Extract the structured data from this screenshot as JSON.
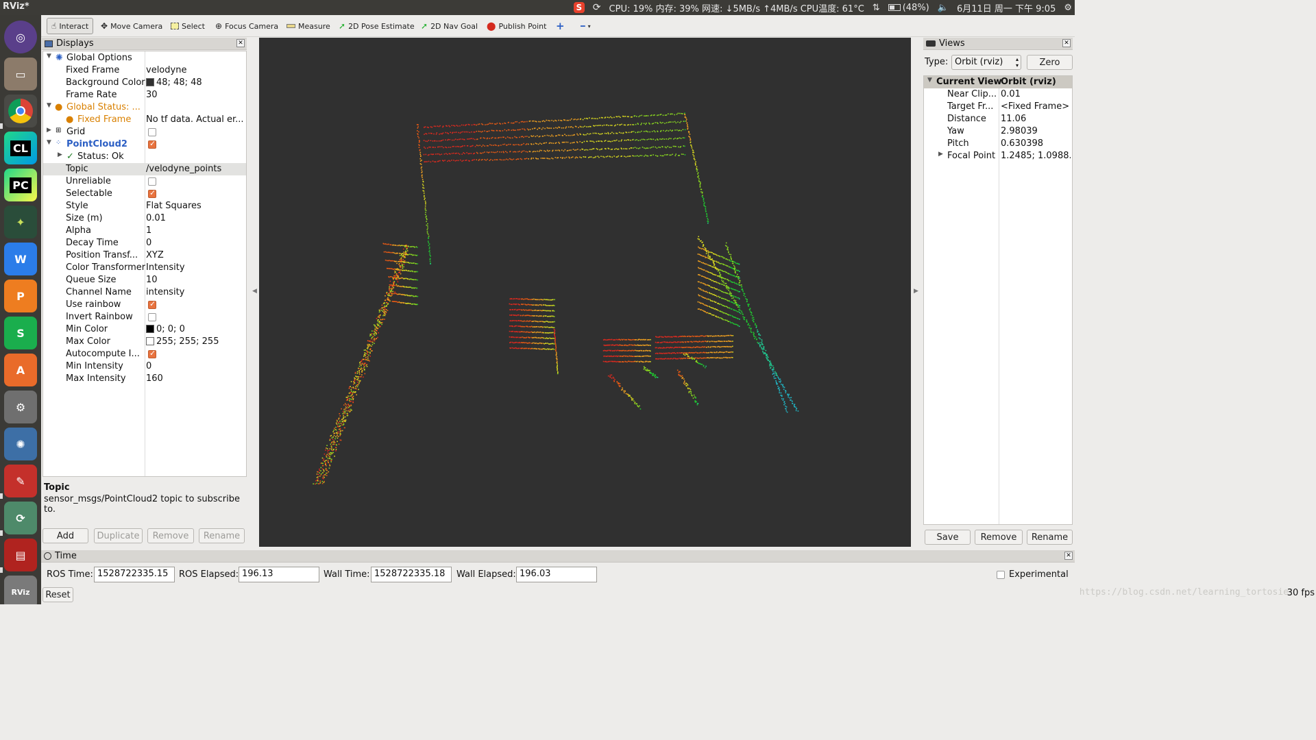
{
  "topbar": {
    "app_title": "RViz*",
    "status": "CPU: 19% 内存: 39% 网速: ↓5MB/s ↑4MB/s CPU温度: 61°C",
    "battery": "(48%)",
    "datetime": "6月11日 周一 下午 9:05"
  },
  "toolbar": {
    "interact": "Interact",
    "move_camera": "Move Camera",
    "select": "Select",
    "focus_camera": "Focus Camera",
    "measure": "Measure",
    "pose_estimate": "2D Pose Estimate",
    "nav_goal": "2D Nav Goal",
    "publish_point": "Publish Point"
  },
  "displays": {
    "title": "Displays",
    "rows": [
      {
        "name": "Global Options",
        "value": ""
      },
      {
        "name": "Fixed Frame",
        "value": "velodyne"
      },
      {
        "name": "Background Color",
        "value": "48; 48; 48"
      },
      {
        "name": "Frame Rate",
        "value": "30"
      },
      {
        "name": "Global Status: ...",
        "value": ""
      },
      {
        "name": "Fixed Frame",
        "value": "No tf data.  Actual er..."
      },
      {
        "name": "Grid",
        "value": ""
      },
      {
        "name": "PointCloud2",
        "value": ""
      },
      {
        "name": "Status: Ok",
        "value": ""
      },
      {
        "name": "Topic",
        "value": "/velodyne_points"
      },
      {
        "name": "Unreliable",
        "value": ""
      },
      {
        "name": "Selectable",
        "value": ""
      },
      {
        "name": "Style",
        "value": "Flat Squares"
      },
      {
        "name": "Size (m)",
        "value": "0.01"
      },
      {
        "name": "Alpha",
        "value": "1"
      },
      {
        "name": "Decay Time",
        "value": "0"
      },
      {
        "name": "Position Transf...",
        "value": "XYZ"
      },
      {
        "name": "Color Transformer",
        "value": "Intensity"
      },
      {
        "name": "Queue Size",
        "value": "10"
      },
      {
        "name": "Channel Name",
        "value": "intensity"
      },
      {
        "name": "Use rainbow",
        "value": ""
      },
      {
        "name": "Invert Rainbow",
        "value": ""
      },
      {
        "name": "Min Color",
        "value": "0; 0; 0"
      },
      {
        "name": "Max Color",
        "value": "255; 255; 255"
      },
      {
        "name": "Autocompute I...",
        "value": ""
      },
      {
        "name": "Min Intensity",
        "value": "0"
      },
      {
        "name": "Max Intensity",
        "value": "160"
      }
    ],
    "desc_title": "Topic",
    "desc_text": "sensor_msgs/PointCloud2 topic to subscribe to.",
    "buttons": {
      "add": "Add",
      "duplicate": "Duplicate",
      "remove": "Remove",
      "rename": "Rename"
    }
  },
  "views": {
    "title": "Views",
    "type_label": "Type:",
    "type_value": "Orbit (rviz)",
    "zero": "Zero",
    "rows": [
      {
        "name": "Current View",
        "value": "Orbit (rviz)"
      },
      {
        "name": "Near Clip...",
        "value": "0.01"
      },
      {
        "name": "Target Fr...",
        "value": "<Fixed Frame>"
      },
      {
        "name": "Distance",
        "value": "11.06"
      },
      {
        "name": "Yaw",
        "value": "2.98039"
      },
      {
        "name": "Pitch",
        "value": "0.630398"
      },
      {
        "name": "Focal Point",
        "value": "1.2485; 1.0988..."
      }
    ],
    "buttons": {
      "save": "Save",
      "remove": "Remove",
      "rename": "Rename"
    }
  },
  "time": {
    "title": "Time",
    "ros_time_label": "ROS Time:",
    "ros_time": "1528722335.15",
    "ros_elapsed_label": "ROS Elapsed:",
    "ros_elapsed": "196.13",
    "wall_time_label": "Wall Time:",
    "wall_time": "1528722335.18",
    "wall_elapsed_label": "Wall Elapsed:",
    "wall_elapsed": "196.03",
    "experimental": "Experimental",
    "reset": "Reset",
    "fps": "30 fps"
  },
  "watermark": "https://blog.csdn.net/learning_tortosie",
  "colors": {
    "background": "#303030",
    "accent": "#e8733f",
    "warning": "#d98000",
    "link": "#2c5fc4"
  },
  "launcher_icons": [
    "ubuntu-dash-icon",
    "files-icon",
    "chrome-icon",
    "clion-icon",
    "pycharm-icon",
    "ros-icon",
    "wps-writer-icon",
    "wps-presentation-icon",
    "wps-spreadsheet-icon",
    "software-center-icon",
    "system-settings-icon",
    "shotwell-icon",
    "gedit-icon",
    "software-updater-icon",
    "terminal-icon",
    "rviz-icon"
  ]
}
